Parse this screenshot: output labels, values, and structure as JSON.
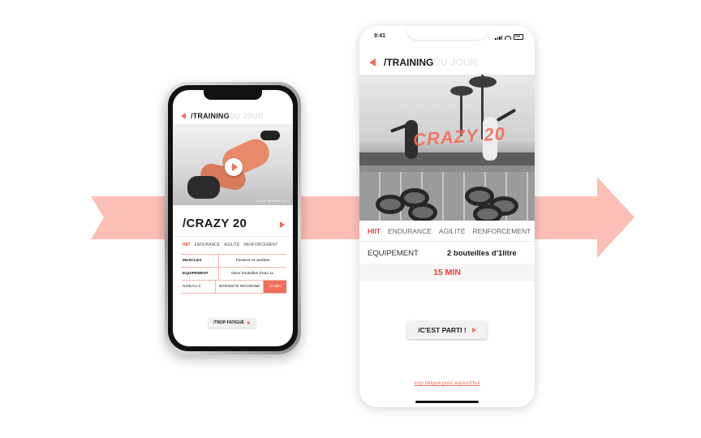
{
  "colors": {
    "accent": "#f26d5b",
    "arrow": "#fbbfb6",
    "text": "#1a1a1a"
  },
  "left_phone": {
    "header": {
      "title": "/TRAINING",
      "ghost": "DU JOUR",
      "back_icon": "back-arrow-icon"
    },
    "video": {
      "caption": "GLUTE BRIDGE HIIT",
      "play_icon": "play-icon"
    },
    "workout_name": "/CRAZY 20",
    "tags": [
      "HIIT",
      "ENDURANCE",
      "AGILITÉ",
      "RENFORCEMENT"
    ],
    "rows": [
      {
        "label": "MUSCLES",
        "value": "Fessiers et Jambes"
      },
      {
        "label": "EQUIPEMENT",
        "value": "Deux bouteilles d'eau 1L"
      }
    ],
    "meta": {
      "level": "NIVEAU 3",
      "intensity": "INTENSITE MOYENNE",
      "duration": "15 MIN"
    },
    "button": "/TROP FATIGUÉ"
  },
  "right_phone": {
    "status": {
      "time": "9:41"
    },
    "header": {
      "title": "/TRAINING",
      "ghost": "DU JOUR",
      "back_icon": "back-arrow-icon"
    },
    "photo_overlay": "CRAZY 20",
    "tags": [
      "HIIT",
      "ENDURANCE",
      "AGILITÉ",
      "RENFORCEMENT"
    ],
    "equipment": {
      "label": "EQUIPEMENT",
      "value": "2 bouteilles d'1litre"
    },
    "duration": "15 MIN",
    "button": "/C'EST PARTI !",
    "link": "trop fatigué pour aujourd'hui"
  }
}
